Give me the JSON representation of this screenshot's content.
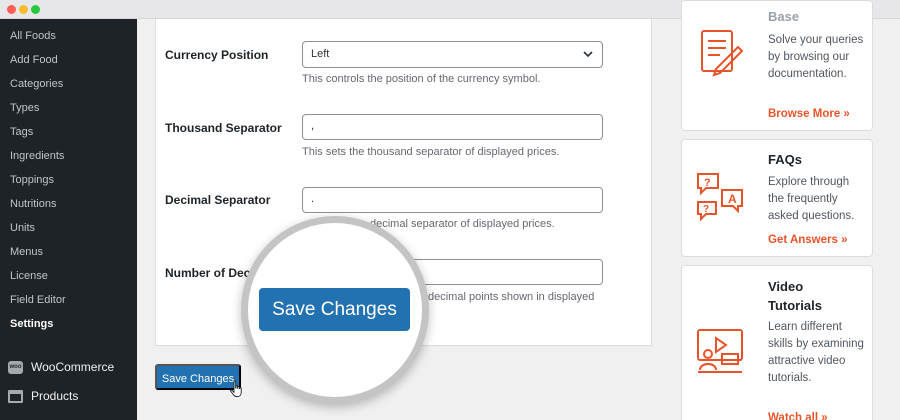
{
  "sidebar": {
    "items": [
      {
        "label": "All Foods"
      },
      {
        "label": "Add Food"
      },
      {
        "label": "Categories"
      },
      {
        "label": "Types"
      },
      {
        "label": "Tags"
      },
      {
        "label": "Ingredients"
      },
      {
        "label": "Toppings"
      },
      {
        "label": "Nutritions"
      },
      {
        "label": "Units"
      },
      {
        "label": "Menus"
      },
      {
        "label": "License"
      },
      {
        "label": "Field Editor"
      },
      {
        "label": "Settings",
        "active": true
      }
    ],
    "menus": [
      {
        "label": "WooCommerce",
        "icon": "woocommerce-icon",
        "icon_text": "woo"
      },
      {
        "label": "Products",
        "icon": "products-icon"
      }
    ]
  },
  "settings": {
    "currency_position": {
      "label": "Currency Position",
      "value": "Left",
      "description": "This controls the position of the currency symbol."
    },
    "thousand_separator": {
      "label": "Thousand Separator",
      "value": ",",
      "description": "This sets the thousand separator of displayed prices."
    },
    "decimal_separator": {
      "label": "Decimal Separator",
      "value": ".",
      "description": "decimal separator of displayed prices."
    },
    "number_of_decimals": {
      "label": "Number of Dec",
      "value": "",
      "description": "decimal points shown in displayed"
    }
  },
  "save_button_label": "Save Changes",
  "magnifier": {
    "button_label": "Save Changes"
  },
  "help_cards": [
    {
      "title": "Base",
      "text": "Solve your queries by browsing our documentation.",
      "link": "Browse More »",
      "icon": "document-edit-icon"
    },
    {
      "title": "FAQs",
      "text": "Explore through the frequently asked questions.",
      "link": "Get Answers »",
      "icon": "faq-bubbles-icon"
    },
    {
      "title": "Video Tutorials",
      "text": "Learn different skills by examining attractive video tutorials.",
      "link": "Watch all »",
      "icon": "video-tutorial-icon"
    }
  ],
  "colors": {
    "accent": "#2271b1",
    "sidebar_bg": "#1d2327",
    "link": "#e8542a",
    "icon": "#e8542a"
  }
}
